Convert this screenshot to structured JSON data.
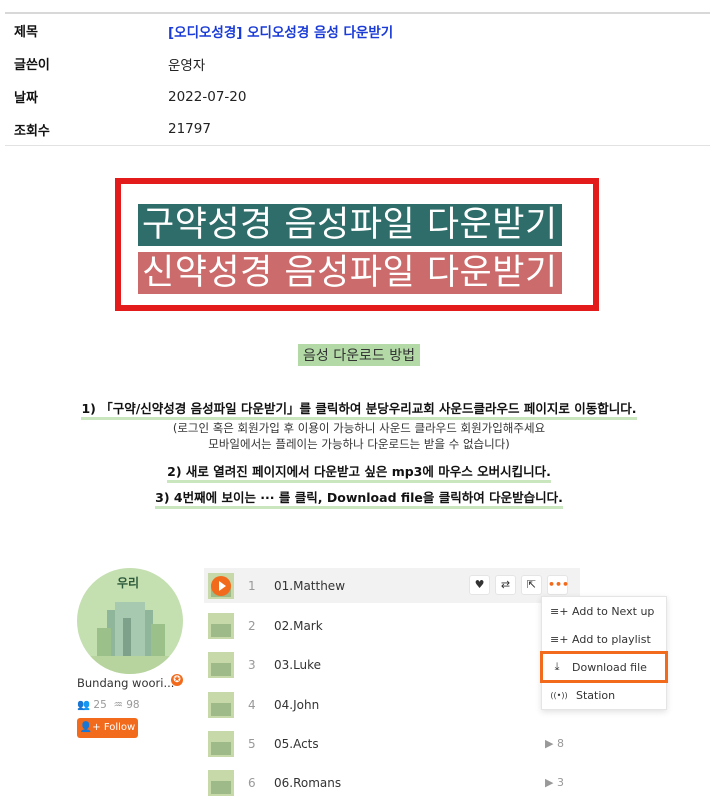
{
  "info": {
    "rows": [
      {
        "label": "제목",
        "value": "[오디오성경] 오디오성경 음성 다운받기"
      },
      {
        "label": "글쓴이",
        "value": "운영자"
      },
      {
        "label": "날짜",
        "value": "2022-07-20"
      },
      {
        "label": "조회수",
        "value": "21797"
      }
    ]
  },
  "banner": {
    "old_testament": "구약성경 음성파일 다운받기",
    "new_testament": "신약성경 음성파일 다운받기",
    "border_color": "#e31b1b",
    "old_bg": "#2e6d6a",
    "new_bg": "#cc6b6b"
  },
  "instructions": {
    "title": "음성 다운로드 방법",
    "step1": "1) 「구약/신약성경 음성파일 다운받기」를 클릭하여 분당우리교회 사운드클라우드 페이지로 이동합니다.",
    "note1": "(로그인 혹은 회원가입 후 이용이 가능하니 사운드 클라우드 회원가입해주세요",
    "note2": "모바일에서는 플레이는 가능하나 다운로드는 받을 수 없습니다)",
    "step2": "2) 새로 열려진 페이지에서 다운받고 싶은 mp3에 마우스 오버시킵니다.",
    "step3": "3) 4번째에 보이는 ··· 를 클릭, Download file을 클릭하여 다운받습니다."
  },
  "artist": {
    "name": "Bundang woori...",
    "followers": "25",
    "tracks": "98",
    "follow_label": "Follow",
    "avatar_text": "우리"
  },
  "tracks": [
    {
      "num": "1",
      "title": "01.Matthew",
      "plays": ""
    },
    {
      "num": "2",
      "title": "02.Mark",
      "plays": ""
    },
    {
      "num": "3",
      "title": "03.Luke",
      "plays": ""
    },
    {
      "num": "4",
      "title": "04.John",
      "plays": ""
    },
    {
      "num": "5",
      "title": "05.Acts",
      "plays": "▶ 8"
    },
    {
      "num": "6",
      "title": "06.Romans",
      "plays": "▶ 3"
    }
  ],
  "menu": {
    "items": [
      {
        "label": "Add to Next up",
        "icon": "≡+"
      },
      {
        "label": "Add to playlist",
        "icon": "≡+"
      },
      {
        "label": "Download file",
        "icon": "⤓"
      },
      {
        "label": "Station",
        "icon": "((•))"
      }
    ]
  },
  "colors": {
    "accent": "#f26b1d",
    "link": "#1a3bd6"
  }
}
